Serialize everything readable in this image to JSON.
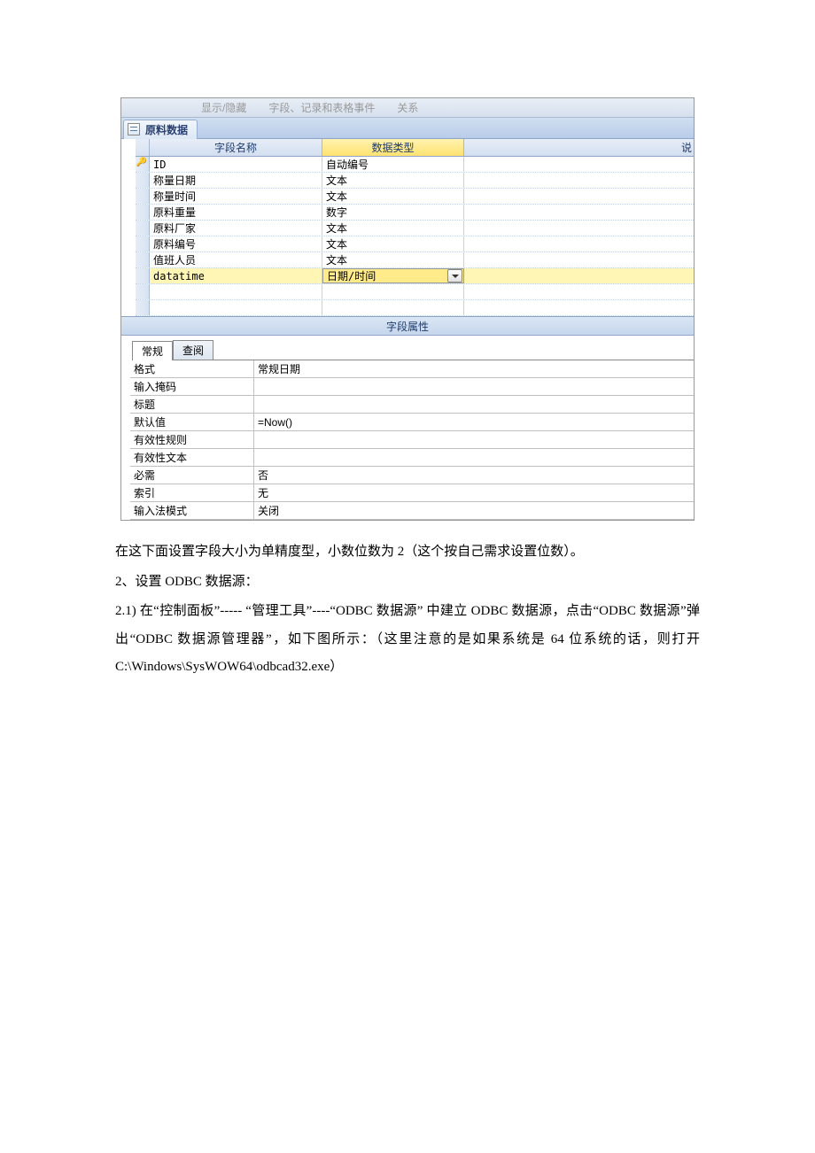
{
  "toolbar": {
    "item1": "显示/隐藏",
    "item2": "字段、记录和表格事件",
    "item3": "关系"
  },
  "tab": {
    "title": "原料数据"
  },
  "headers": {
    "field_name": "字段名称",
    "data_type": "数据类型",
    "desc": "说"
  },
  "fields": [
    {
      "name": "ID",
      "type": "自动编号",
      "pk": true
    },
    {
      "name": "称量日期",
      "type": "文本"
    },
    {
      "name": "称量时间",
      "type": "文本"
    },
    {
      "name": "原料重量",
      "type": "数字"
    },
    {
      "name": "原料厂家",
      "type": "文本"
    },
    {
      "name": "原料编号",
      "type": "文本"
    },
    {
      "name": "值班人员",
      "type": "文本"
    },
    {
      "name": "datatime",
      "type": "日期/时间",
      "selected": true
    }
  ],
  "props_header": "字段属性",
  "prop_tabs": {
    "general": "常规",
    "lookup": "查阅"
  },
  "props": [
    {
      "label": "格式",
      "value": "常规日期"
    },
    {
      "label": "输入掩码",
      "value": ""
    },
    {
      "label": "标题",
      "value": ""
    },
    {
      "label": "默认值",
      "value": "=Now()"
    },
    {
      "label": "有效性规则",
      "value": ""
    },
    {
      "label": "有效性文本",
      "value": ""
    },
    {
      "label": "必需",
      "value": "否"
    },
    {
      "label": "索引",
      "value": "无"
    },
    {
      "label": "输入法模式",
      "value": "关闭"
    }
  ],
  "doc": {
    "p1": "在这下面设置字段大小为单精度型，小数位数为 2（这个按自己需求设置位数）。",
    "p2": "2、设置 ODBC  数据源：",
    "p3": "2.1)  在“控制面板”----- “管理工具”----“ODBC  数据源” 中建立 ODBC  数据源，点击“ODBC 数据源”弹出“ODBC  数据源管理器”，如下图所示：（这里注意的是如果系统是 64 位系统的话，则打开 C:\\Windows\\SysWOW64\\odbcad32.exe）"
  }
}
